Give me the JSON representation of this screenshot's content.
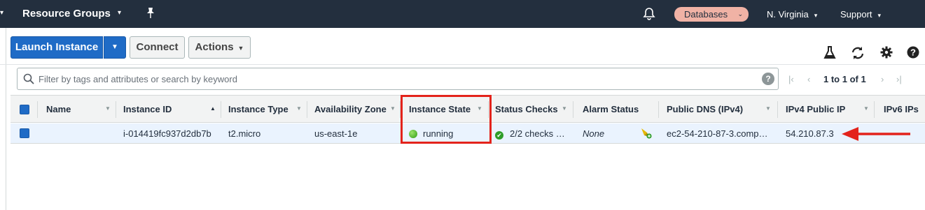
{
  "topnav": {
    "resource_groups": "Resource Groups",
    "databases": "Databases",
    "region": "N. Virginia",
    "support": "Support"
  },
  "toolbar": {
    "launch_instance": "Launch Instance",
    "connect": "Connect",
    "actions": "Actions"
  },
  "search": {
    "placeholder": "Filter by tags and attributes or search by keyword"
  },
  "pager": {
    "text": "1 to 1 of 1"
  },
  "table": {
    "columns": [
      "Name",
      "Instance ID",
      "Instance Type",
      "Availability Zone",
      "Instance State",
      "Status Checks",
      "Alarm Status",
      "Public DNS (IPv4)",
      "IPv4 Public IP",
      "IPv6 IPs"
    ],
    "rows": [
      {
        "name": "",
        "instance_id": "i-014419fc937d2db7b",
        "instance_type": "t2.micro",
        "availability_zone": "us-east-1e",
        "instance_state": "running",
        "status_checks": "2/2 checks …",
        "alarm_status": "None",
        "public_dns": "ec2-54-210-87-3.comp…",
        "ipv4_public_ip": "54.210.87.3"
      }
    ]
  },
  "colors": {
    "nav_bg": "#232f3e",
    "primary": "#1f6bc6",
    "highlight": "#e3231b",
    "running": "#2f9c12"
  },
  "icons": [
    "pin-icon",
    "bell-icon",
    "flask-icon",
    "refresh-icon",
    "gear-icon",
    "help-icon",
    "search-icon",
    "add-alarm-icon"
  ]
}
